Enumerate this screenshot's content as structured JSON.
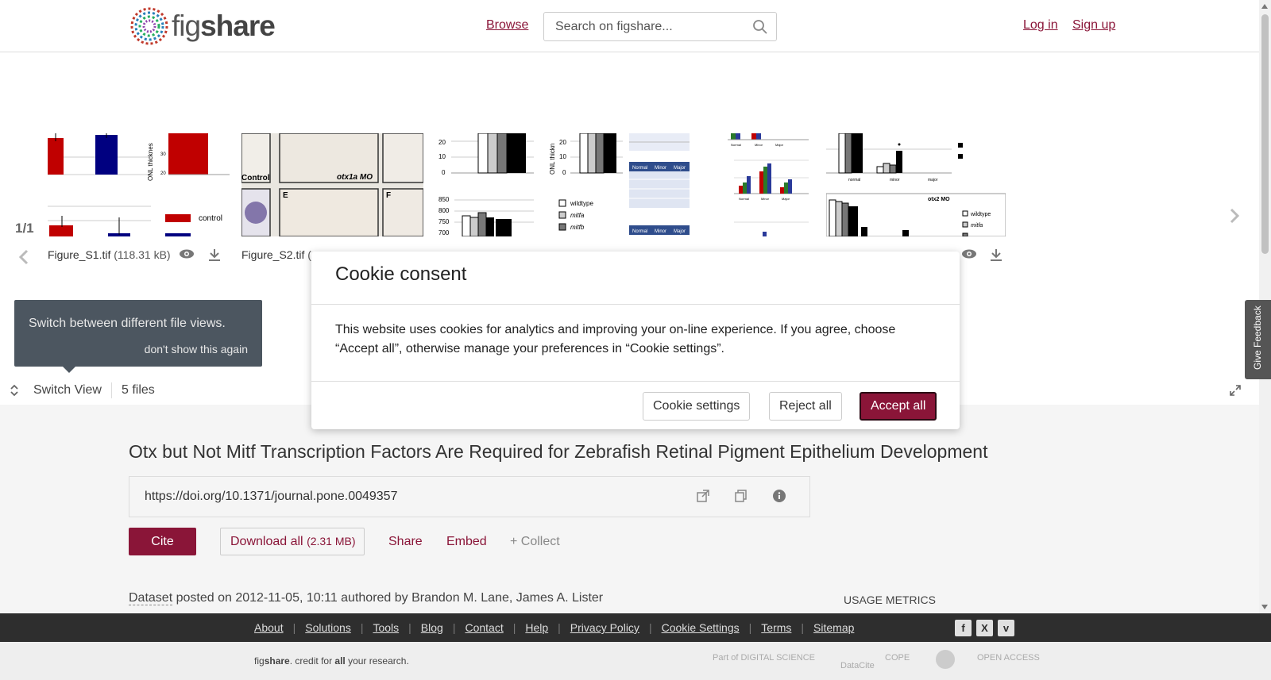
{
  "header": {
    "logo_text_a": "fig",
    "logo_text_b": "share",
    "browse": "Browse",
    "search_placeholder": "Search on figshare...",
    "login": "Log in",
    "signup": "Sign up"
  },
  "viewer": {
    "counter": "1/1",
    "files": [
      {
        "name": "Figure_S1.tif",
        "size": "(118.31 kB)"
      },
      {
        "name": "Figure_S2.tif",
        "size": "("
      }
    ],
    "thumb_texts": {
      "s1_label": "ONL thicknes",
      "s1_legend": "control",
      "s2_control": "Control",
      "s2_otx1a": "otx1a MO",
      "s2_e": "E",
      "s2_f": "F",
      "s3_ticks": [
        "20",
        "10",
        "0",
        "850",
        "800",
        "750",
        "700"
      ],
      "s4_label": "ONL thickn",
      "s4_ticks": [
        "20",
        "10",
        "0"
      ],
      "s4_legend": [
        "wildtype",
        "mitfa",
        "mitfb"
      ],
      "s5_head": [
        "Normal",
        "Minor",
        "Major"
      ],
      "s6_axis": [
        "Normal",
        "Minor",
        "Major"
      ],
      "s7_otx2": "otx2 MO",
      "s7_legend": [
        "wildtype",
        "mitfa",
        "mitfb"
      ],
      "s7_axis": [
        "normal",
        "minor",
        "major"
      ]
    },
    "tooltip_msg": "Switch between different file views.",
    "tooltip_dont": "don't show this again",
    "switch_view": "Switch View",
    "files_count": "5 files"
  },
  "modal": {
    "title": "Cookie consent",
    "body": "This website uses cookies for analytics and improving your on-line experience. If you agree, choose “Accept all”, otherwise manage your preferences in “Cookie settings”.",
    "settings": "Cookie settings",
    "reject": "Reject all",
    "accept": "Accept all"
  },
  "feedback": "Give Feedback",
  "article": {
    "title": "Otx but Not Mitf Transcription Factors Are Required for Zebrafish Retinal Pigment Epithelium Development",
    "doi": "https://doi.org/10.1371/journal.pone.0049357",
    "cite": "Cite",
    "download": "Download all",
    "download_size": "(2.31 MB)",
    "share": "Share",
    "embed": "Embed",
    "collect": "+ Collect",
    "item_type": "Dataset",
    "posted_text": " posted on 2012-11-05, 10:11 authored by Brandon M. Lane, James A. Lister",
    "usage": "USAGE METRICS"
  },
  "footer": {
    "links": [
      "About",
      "Solutions",
      "Tools",
      "Blog",
      "Contact",
      "Help",
      "Privacy Policy",
      "Cookie Settings",
      "Terms",
      "Sitemap"
    ],
    "tagline_a": "fig",
    "tagline_b": "share",
    "tagline_c": ". credit for ",
    "tagline_d": "all",
    "tagline_e": " your research.",
    "social": [
      "f",
      "X",
      "v"
    ],
    "partners": [
      "Part of DIGITAL SCIENCE",
      "DataCite",
      "COPE",
      "",
      "OPEN ACCESS"
    ]
  },
  "colors": {
    "brand": "#8a1538",
    "footer_dark": "#2e2e2e",
    "tooltip": "#3f4a55"
  }
}
